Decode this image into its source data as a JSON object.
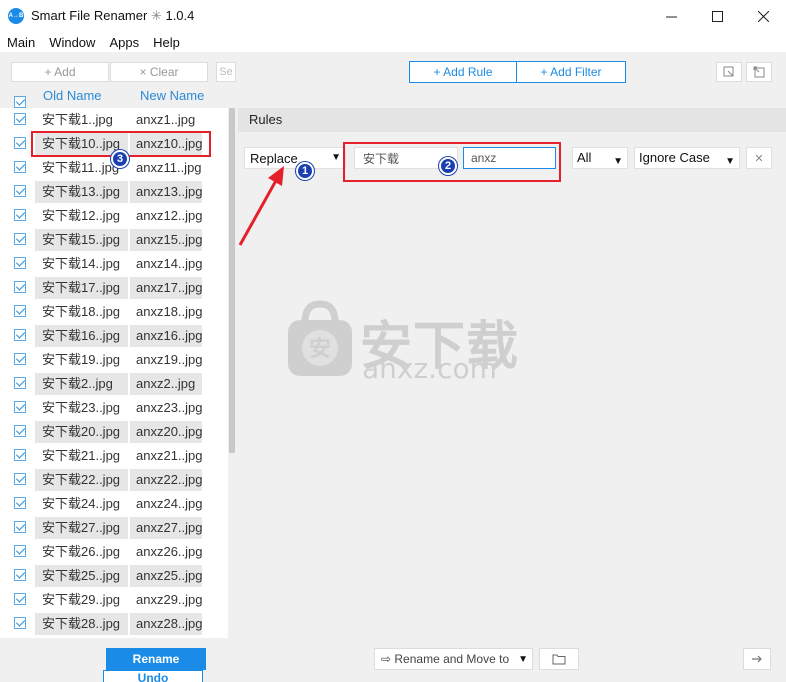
{
  "window": {
    "title": "Smart File Renamer",
    "version_glyph": "✳",
    "version": "1.0.4",
    "logo_text": "A→B"
  },
  "menu": [
    "Main",
    "Window",
    "Apps",
    "Help"
  ],
  "toolbar": {
    "add_label": "+ Add",
    "clear_label": "× Clear",
    "small_label": "Se"
  },
  "columns": {
    "old_name": "Old Name",
    "new_name": "New Name"
  },
  "files": [
    {
      "old": "安下载1..jpg",
      "new": "anxz1..jpg"
    },
    {
      "old": "安下载10..jpg",
      "new": "anxz10..jpg"
    },
    {
      "old": "安下载11..jpg",
      "new": "anxz11..jpg"
    },
    {
      "old": "安下载13..jpg",
      "new": "anxz13..jpg"
    },
    {
      "old": "安下载12..jpg",
      "new": "anxz12..jpg"
    },
    {
      "old": "安下载15..jpg",
      "new": "anxz15..jpg"
    },
    {
      "old": "安下载14..jpg",
      "new": "anxz14..jpg"
    },
    {
      "old": "安下载17..jpg",
      "new": "anxz17..jpg"
    },
    {
      "old": "安下载18..jpg",
      "new": "anxz18..jpg"
    },
    {
      "old": "安下载16..jpg",
      "new": "anxz16..jpg"
    },
    {
      "old": "安下载19..jpg",
      "new": "anxz19..jpg"
    },
    {
      "old": "安下载2..jpg",
      "new": "anxz2..jpg"
    },
    {
      "old": "安下载23..jpg",
      "new": "anxz23..jpg"
    },
    {
      "old": "安下载20..jpg",
      "new": "anxz20..jpg"
    },
    {
      "old": "安下载21..jpg",
      "new": "anxz21..jpg"
    },
    {
      "old": "安下载22..jpg",
      "new": "anxz22..jpg"
    },
    {
      "old": "安下载24..jpg",
      "new": "anxz24..jpg"
    },
    {
      "old": "安下载27..jpg",
      "new": "anxz27..jpg"
    },
    {
      "old": "安下载26..jpg",
      "new": "anxz26..jpg"
    },
    {
      "old": "安下载25..jpg",
      "new": "anxz25..jpg"
    },
    {
      "old": "安下载29..jpg",
      "new": "anxz29..jpg"
    },
    {
      "old": "安下载28..jpg",
      "new": "anxz28..jpg"
    }
  ],
  "actions": {
    "rename_label": "Rename",
    "undo_label": "Undo",
    "rename_move_label": "⇨ Rename and Move to"
  },
  "rules_panel": {
    "add_rule_label": "+ Add Rule",
    "add_filter_label": "+ Add Filter",
    "title": "Rules",
    "rule": {
      "type": "Replace",
      "find": "安下载",
      "replace": "anxz",
      "scope": "All",
      "case": "Ignore Case",
      "remove_glyph": "✕"
    }
  },
  "annotations": {
    "badge_1": "1",
    "badge_2": "2",
    "badge_3": "3"
  },
  "watermark": {
    "cn": "安下载",
    "en": "anxz.com",
    "bag_char": "安"
  },
  "colors": {
    "accent": "#1a8be6",
    "highlight": "#e4202a",
    "badge": "#1a3fb0"
  }
}
